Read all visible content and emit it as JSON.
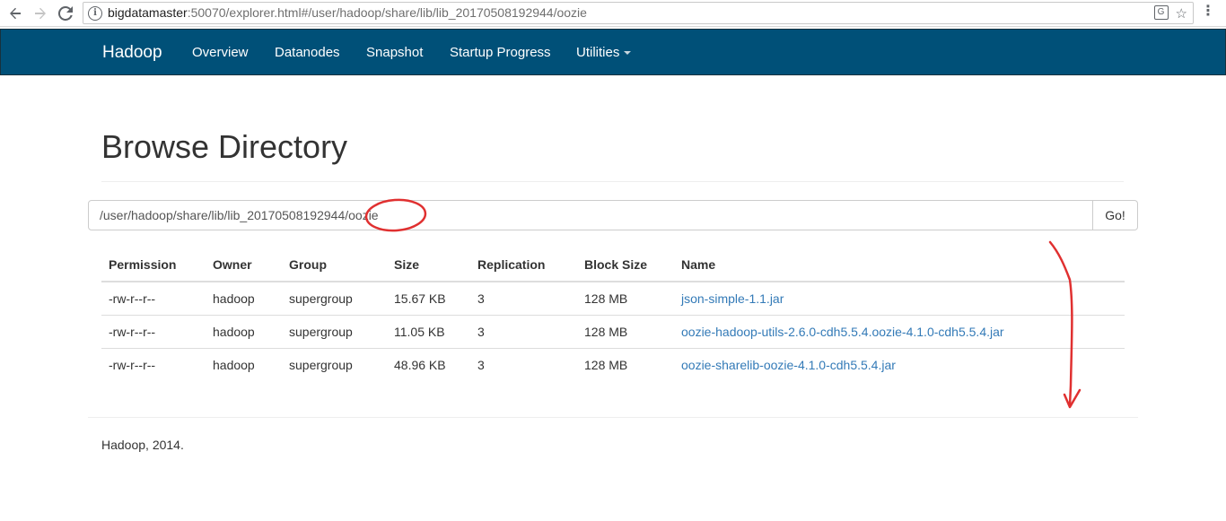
{
  "browser": {
    "url_host": "bigdatamaster",
    "url_rest": ":50070/explorer.html#/user/hadoop/share/lib/lib_20170508192944/oozie"
  },
  "navbar": {
    "brand": "Hadoop",
    "links": [
      "Overview",
      "Datanodes",
      "Snapshot",
      "Startup Progress",
      "Utilities"
    ]
  },
  "page": {
    "title": "Browse Directory",
    "path_value": "/user/hadoop/share/lib/lib_20170508192944/oozie",
    "go_label": "Go!"
  },
  "table": {
    "headers": [
      "Permission",
      "Owner",
      "Group",
      "Size",
      "Replication",
      "Block Size",
      "Name"
    ],
    "rows": [
      [
        "-rw-r--r--",
        "hadoop",
        "supergroup",
        "15.67 KB",
        "3",
        "128 MB",
        "json-simple-1.1.jar"
      ],
      [
        "-rw-r--r--",
        "hadoop",
        "supergroup",
        "11.05 KB",
        "3",
        "128 MB",
        "oozie-hadoop-utils-2.6.0-cdh5.5.4.oozie-4.1.0-cdh5.5.4.jar"
      ],
      [
        "-rw-r--r--",
        "hadoop",
        "supergroup",
        "48.96 KB",
        "3",
        "128 MB",
        "oozie-sharelib-oozie-4.1.0-cdh5.5.4.jar"
      ]
    ]
  },
  "footer": {
    "text": "Hadoop, 2014."
  },
  "colors": {
    "navbar": "#005078",
    "link": "#337ab7",
    "annotation": "#e03030"
  }
}
